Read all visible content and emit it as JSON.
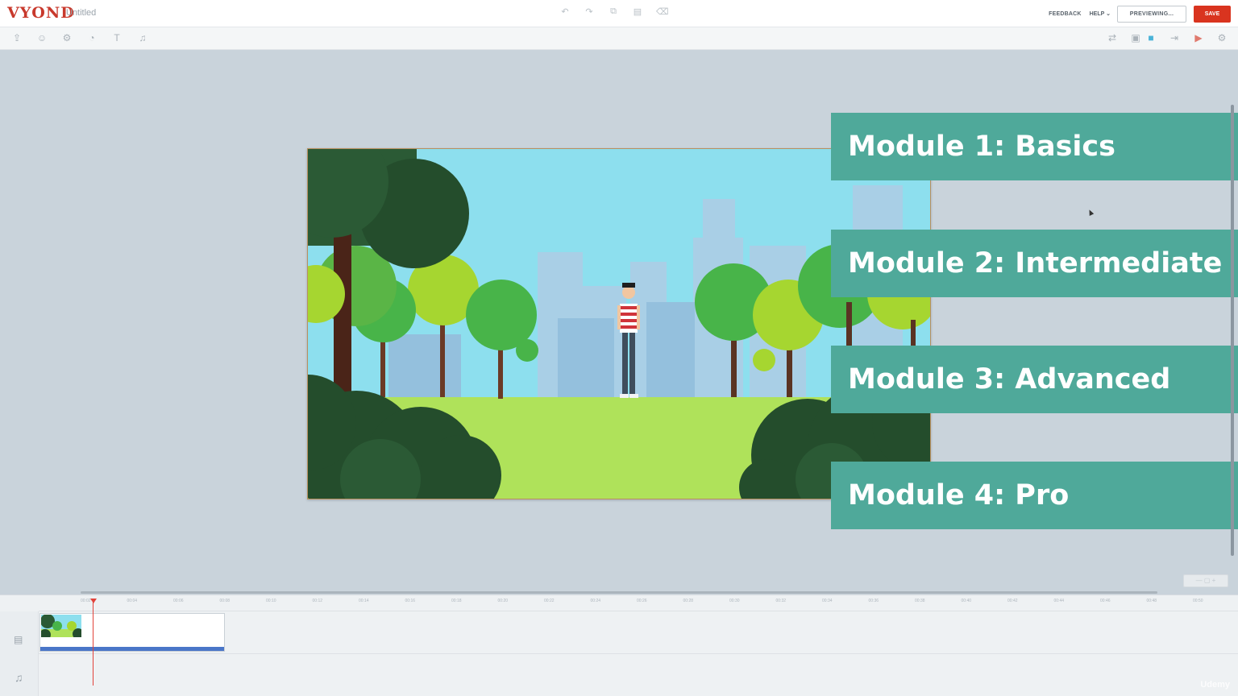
{
  "app": {
    "logo": "VYOND",
    "doc_title": "Untitled"
  },
  "header": {
    "feedback_label": "FEEDBACK",
    "help_label": "HELP",
    "help_caret": "⌄",
    "preview_label": "PREVIEWING...",
    "save_label": "SAVE",
    "center_tools": [
      "undo-icon",
      "redo-icon",
      "copy-icon",
      "paste-icon",
      "delete-icon"
    ]
  },
  "toolbar": {
    "left_tools": [
      "upload-icon",
      "character-icon",
      "prop-icon",
      "chart-icon",
      "text-icon",
      "audio-icon"
    ],
    "right_tools": [
      "swap-icon",
      "background-icon",
      "color-swatch-icon",
      "enter-effect-icon",
      "camera-icon",
      "settings-icon"
    ]
  },
  "modules": [
    {
      "label": "Module 1: Basics"
    },
    {
      "label": "Module 2: Intermediate"
    },
    {
      "label": "Module 3: Advanced"
    },
    {
      "label": "Module 4: Pro"
    }
  ],
  "timeline": {
    "ticks": [
      "00:02",
      "00:04",
      "00:06",
      "00:08",
      "00:10",
      "00:12",
      "00:14",
      "00:16",
      "00:18",
      "00:20",
      "00:22",
      "00:24",
      "00:26",
      "00:28",
      "00:30",
      "00:32",
      "00:34",
      "00:36",
      "00:38",
      "00:40",
      "00:42",
      "00:44",
      "00:46",
      "00:48",
      "00:50",
      "00:52"
    ],
    "zoom_label": "— ▢ +",
    "watermark": "Udemy"
  },
  "colors": {
    "brand": "#c8392c",
    "save": "#d9341f",
    "module_bg": "#4fa99a",
    "stage_bg": "#c9d3db",
    "playhead": "#e2423a",
    "clip_bar": "#4a76c8"
  }
}
